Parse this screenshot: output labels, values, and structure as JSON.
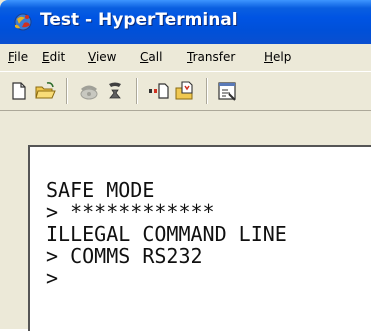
{
  "window": {
    "title": "Test - HyperTerminal",
    "icon": "hyperterminal-app-icon"
  },
  "menu": {
    "items": [
      {
        "first": "F",
        "rest": "ile"
      },
      {
        "first": "E",
        "rest": "dit"
      },
      {
        "first": "V",
        "rest": "iew"
      },
      {
        "first": "C",
        "rest": "all"
      },
      {
        "first": "T",
        "rest": "ransfer"
      },
      {
        "first": "H",
        "rest": "elp"
      }
    ]
  },
  "toolbar": {
    "buttons": [
      "new-icon",
      "open-icon",
      "connect-icon",
      "disconnect-icon",
      "send-icon",
      "receive-icon",
      "properties-icon"
    ]
  },
  "terminal": {
    "lines": [
      "SAFE MODE",
      "> ************",
      "ILLEGAL COMMAND LINE",
      "> COMMS RS232",
      ">"
    ]
  },
  "colors": {
    "titlebar": "#0054e3",
    "chrome": "#ece9d8",
    "terminal_bg": "#ffffff",
    "terminal_text": "#101010"
  }
}
